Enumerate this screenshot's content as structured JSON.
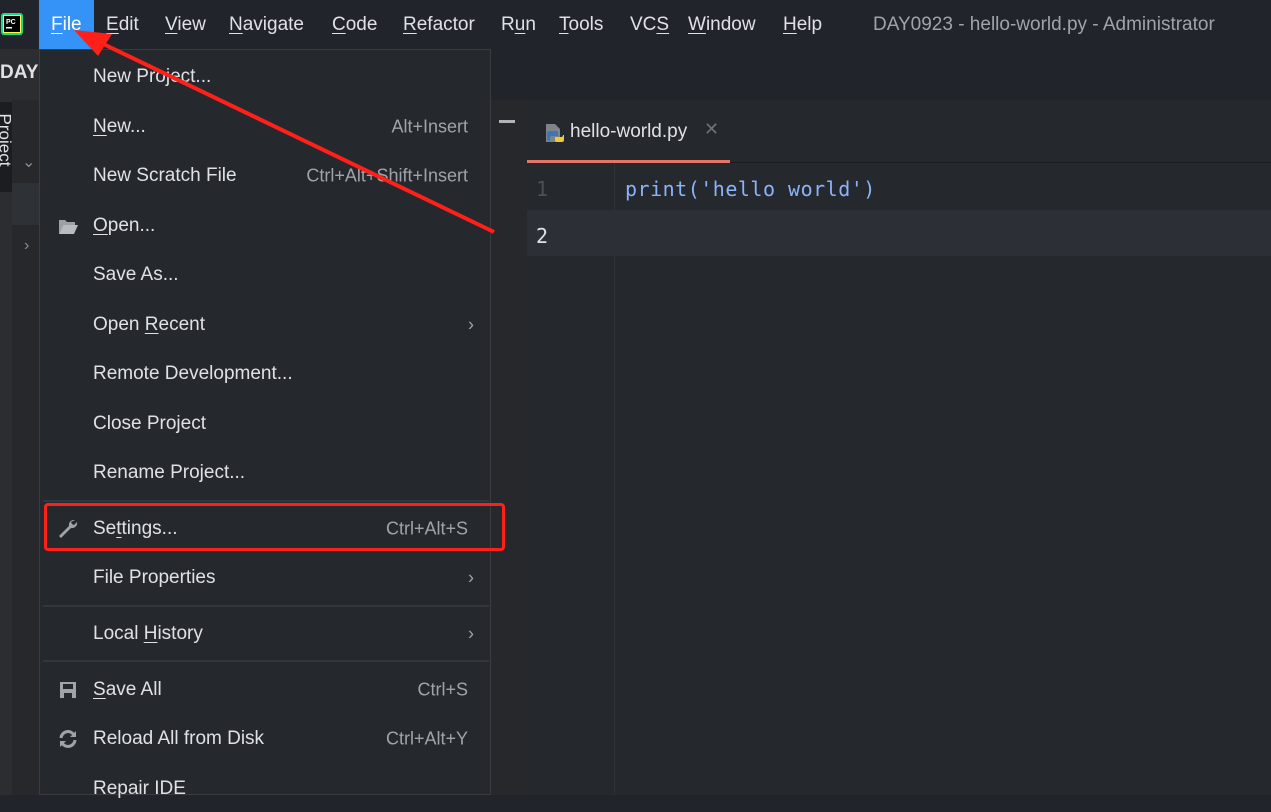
{
  "menubar": {
    "items": [
      {
        "label": "File",
        "mnemonic": "F",
        "rest": "ile",
        "active": true
      },
      {
        "label": "Edit",
        "mnemonic": "E",
        "rest": "dit"
      },
      {
        "label": "View",
        "mnemonic": "V",
        "rest": "iew"
      },
      {
        "label": "Navigate",
        "mnemonic": "N",
        "rest": "avigate"
      },
      {
        "label": "Code",
        "mnemonic": "C",
        "rest": "ode"
      },
      {
        "label": "Refactor",
        "mnemonic": "R",
        "rest": "efactor"
      },
      {
        "label": "Run",
        "pre": "R",
        "mnemonic": "u",
        "rest": "n"
      },
      {
        "label": "Tools",
        "mnemonic": "T",
        "rest": "ools"
      },
      {
        "label": "VCS",
        "pre": "VC",
        "mnemonic": "S",
        "rest": ""
      },
      {
        "label": "Window",
        "mnemonic": "W",
        "rest": "indow"
      },
      {
        "label": "Help",
        "mnemonic": "H",
        "rest": "elp"
      }
    ],
    "window_title": "DAY0923 - hello-world.py - Administrator"
  },
  "project": {
    "title": "DAYC",
    "tool_window_label": "Project"
  },
  "editor": {
    "tab": {
      "label": "hello-world.py",
      "icon": "python-file-icon"
    },
    "lines": [
      {
        "number": "1",
        "code": "print('hello world')"
      },
      {
        "number": "2",
        "code": ""
      }
    ],
    "accent": "#e57564"
  },
  "file_menu": {
    "items": [
      {
        "label": "New Project...",
        "shortcut": ""
      },
      {
        "pre": "",
        "mnemonic": "N",
        "rest": "ew...",
        "shortcut": "Alt+Insert"
      },
      {
        "label": "New Scratch File",
        "shortcut": "Ctrl+Alt+Shift+Insert"
      },
      {
        "pre": "",
        "mnemonic": "O",
        "rest": "pen...",
        "icon": "folder-open-icon"
      },
      {
        "label": "Save As..."
      },
      {
        "pre": "Open ",
        "mnemonic": "R",
        "rest": "ecent",
        "submenu": true
      },
      {
        "label": "Remote Development..."
      },
      {
        "label": "Close Project"
      },
      {
        "label": "Rename Project..."
      },
      {
        "pre": "Se",
        "mnemonic": "t",
        "rest": "tings...",
        "shortcut": "Ctrl+Alt+S",
        "icon": "wrench-icon"
      },
      {
        "label": "File Properties",
        "submenu": true
      },
      {
        "pre": "Local ",
        "mnemonic": "H",
        "rest": "istory",
        "submenu": true
      },
      {
        "pre": "",
        "mnemonic": "S",
        "rest": "ave All",
        "shortcut": "Ctrl+S",
        "icon": "save-icon"
      },
      {
        "label": "Reload All from Disk",
        "shortcut": "Ctrl+Alt+Y",
        "icon": "reload-icon"
      },
      {
        "label": "Repair IDE"
      }
    ],
    "submenu_arrow": "›"
  },
  "annotation": {
    "color": "#ff2019"
  }
}
